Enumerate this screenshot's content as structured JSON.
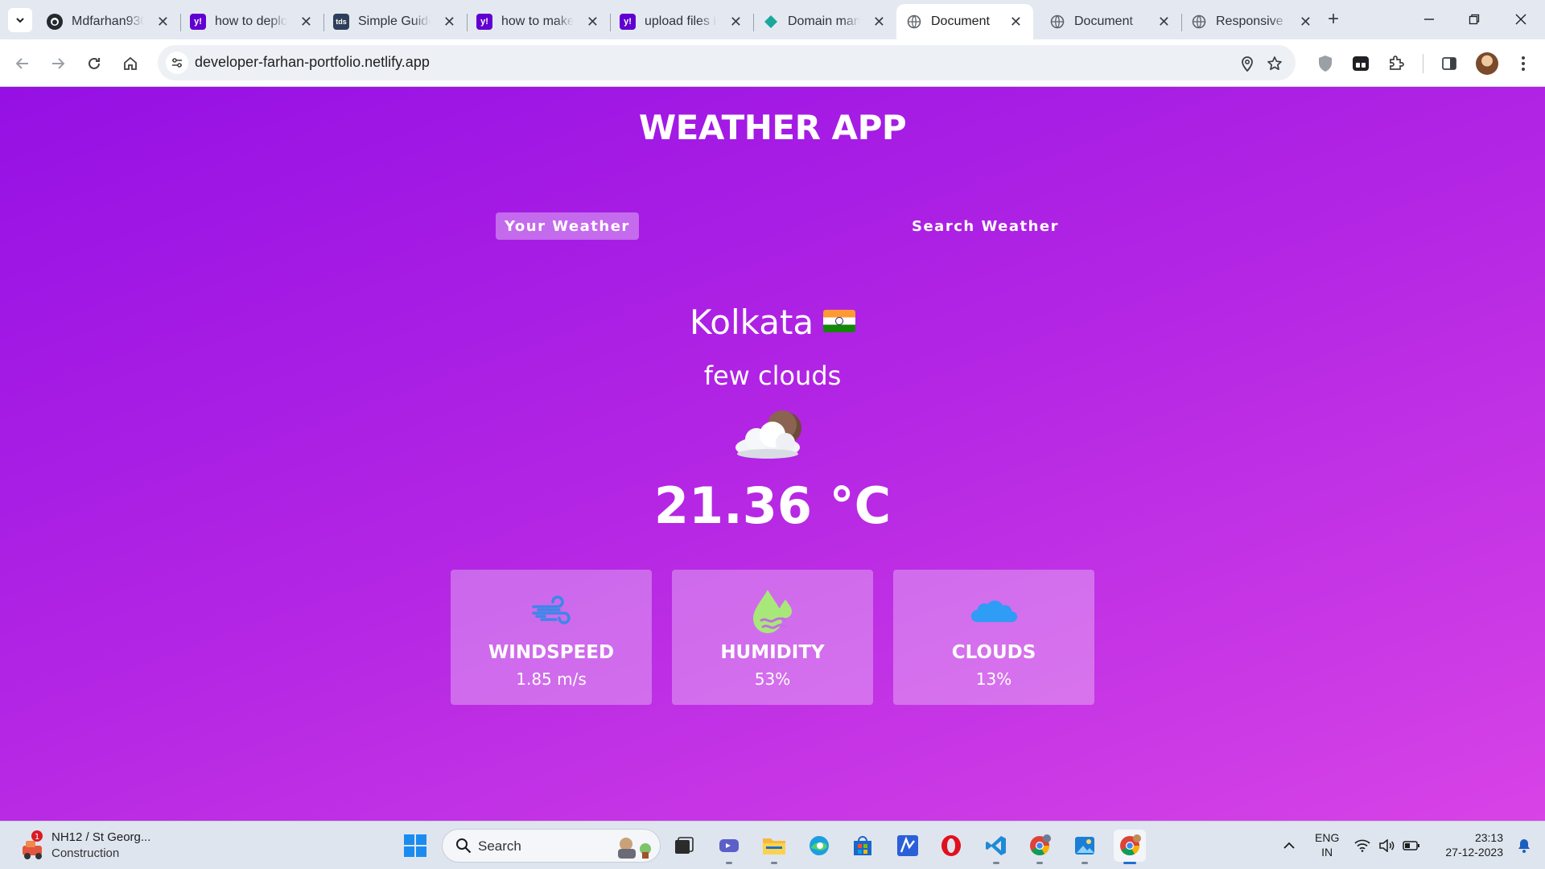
{
  "browser": {
    "tabs": [
      {
        "label": "Mdfarhan930",
        "favicon": "github-icon"
      },
      {
        "label": "how to deploy",
        "favicon": "yahoo-icon"
      },
      {
        "label": "Simple Guide",
        "favicon": "tds-icon"
      },
      {
        "label": "how to make",
        "favicon": "yahoo-icon"
      },
      {
        "label": "upload files in",
        "favicon": "yahoo-icon"
      },
      {
        "label": "Domain man",
        "favicon": "netlify-icon"
      },
      {
        "label": "Document",
        "favicon": "globe-icon",
        "active": true
      },
      {
        "label": "Document",
        "favicon": "globe-icon"
      },
      {
        "label": "Responsive fo",
        "favicon": "globe-icon"
      }
    ],
    "url": "developer-farhan-portfolio.netlify.app"
  },
  "app": {
    "title": "WEATHER APP",
    "tabs": {
      "your_weather": "Your Weather",
      "search_weather": "Search Weather"
    },
    "city": "Kolkata",
    "country_flag": "india-flag",
    "description": "few clouds",
    "weather_icon": "few-clouds-night-icon",
    "temperature": "21.36 °C",
    "cards": [
      {
        "title": "WINDSPEED",
        "value": "1.85 m/s",
        "icon": "wind-icon"
      },
      {
        "title": "HUMIDITY",
        "value": "53%",
        "icon": "humidity-icon"
      },
      {
        "title": "CLOUDS",
        "value": "13%",
        "icon": "cloud-icon"
      }
    ],
    "colors": {
      "gradient_start": "#9510e4",
      "gradient_end": "#d743e6",
      "humidity_icon": "#a8e87a",
      "cloud_icon": "#2f9cf5",
      "wind_icon": "#3b88e8"
    }
  },
  "taskbar": {
    "widget": {
      "title": "NH12 / St Georg...",
      "subtitle": "Construction",
      "badge": "1"
    },
    "search_placeholder": "Search",
    "language": {
      "line1": "ENG",
      "line2": "IN"
    },
    "clock": {
      "time": "23:13",
      "date": "27-12-2023"
    }
  }
}
